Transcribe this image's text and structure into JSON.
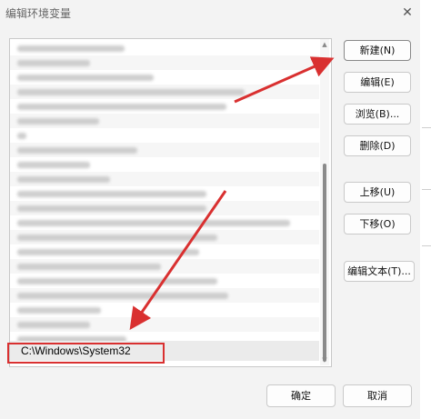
{
  "dialog": {
    "title": "编辑环境变量",
    "close_icon": "close-icon",
    "selected_entry": "C:\\Windows\\System32"
  },
  "buttons": {
    "new": "新建(N)",
    "edit": "编辑(E)",
    "browse": "浏览(B)...",
    "delete": "删除(D)",
    "move_up": "上移(U)",
    "move_down": "下移(O)",
    "edit_text": "编辑文本(T)...",
    "ok": "确定",
    "cancel": "取消"
  },
  "annotations": {
    "color": "#d93030"
  }
}
